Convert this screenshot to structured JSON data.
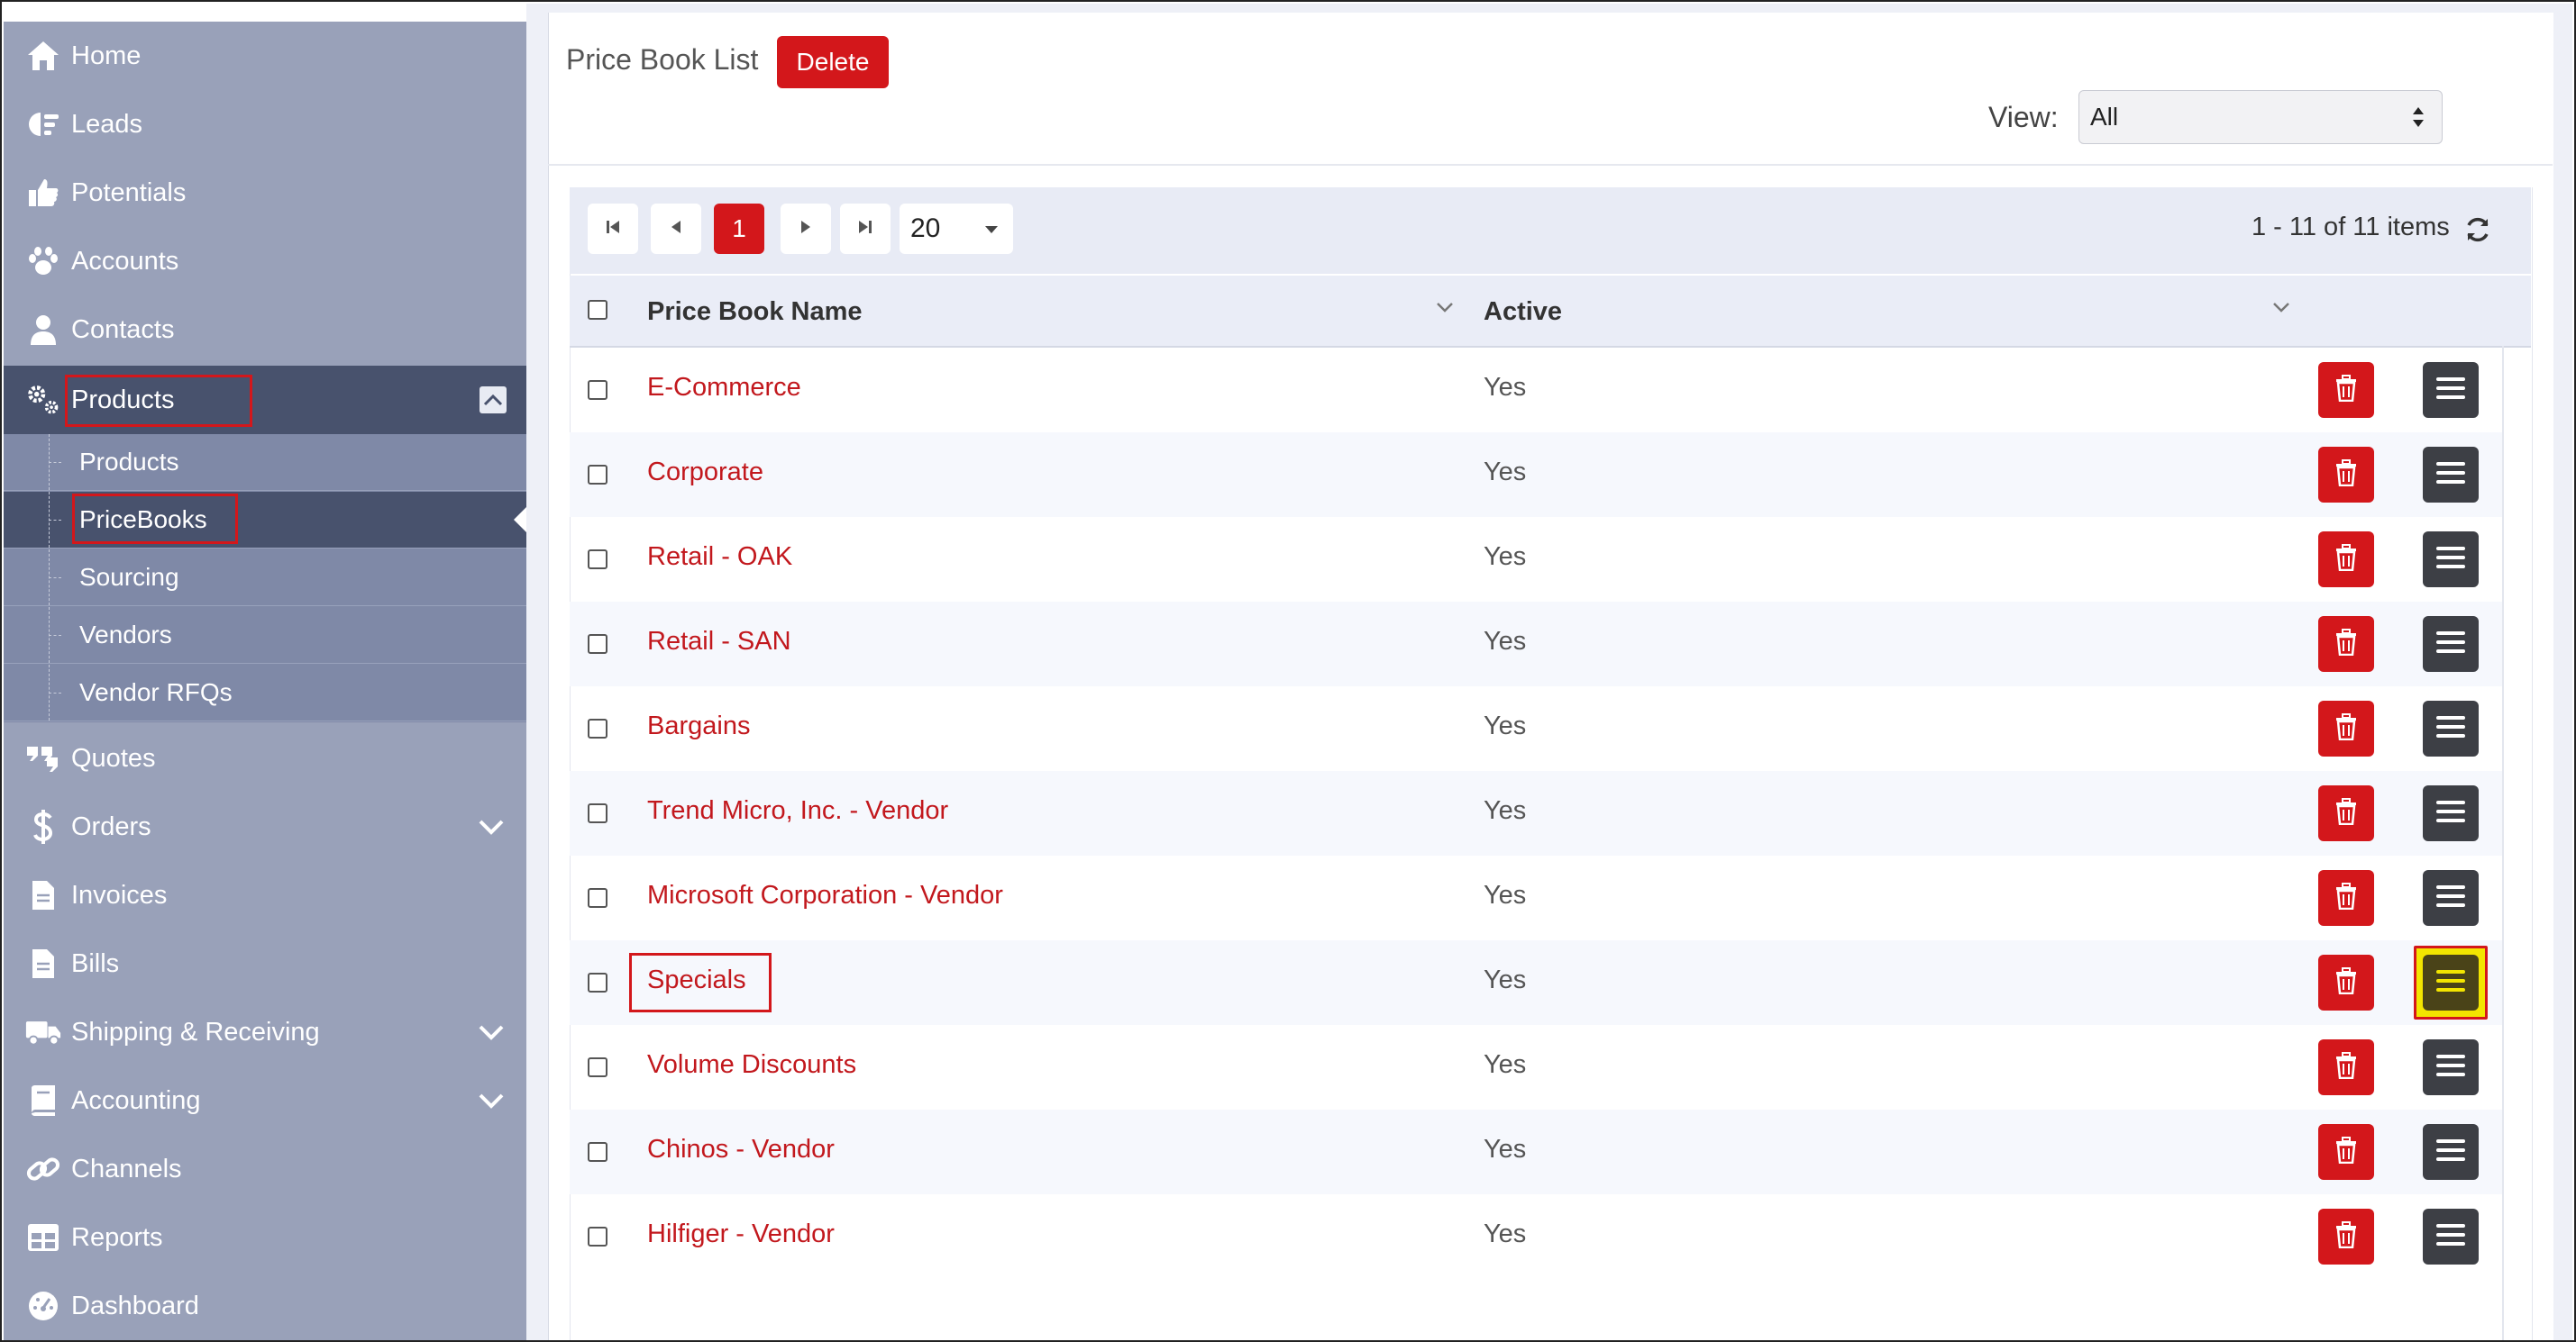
{
  "sidebar": {
    "items": [
      {
        "label": "Home",
        "icon": "home-icon"
      },
      {
        "label": "Leads",
        "icon": "leads-icon"
      },
      {
        "label": "Potentials",
        "icon": "thumbs-up-icon"
      },
      {
        "label": "Accounts",
        "icon": "paw-icon"
      },
      {
        "label": "Contacts",
        "icon": "user-icon"
      },
      {
        "label": "Products",
        "icon": "gears-icon"
      },
      {
        "label": "Quotes",
        "icon": "quote-icon"
      },
      {
        "label": "Orders",
        "icon": "dollar-icon"
      },
      {
        "label": "Invoices",
        "icon": "document-icon"
      },
      {
        "label": "Bills",
        "icon": "document-icon"
      },
      {
        "label": "Shipping & Receiving",
        "icon": "truck-icon"
      },
      {
        "label": "Accounting",
        "icon": "book-icon"
      },
      {
        "label": "Channels",
        "icon": "link-icon"
      },
      {
        "label": "Reports",
        "icon": "table-icon"
      },
      {
        "label": "Dashboard",
        "icon": "gauge-icon"
      }
    ],
    "products_sub": [
      {
        "label": "Products"
      },
      {
        "label": "PriceBooks"
      },
      {
        "label": "Sourcing"
      },
      {
        "label": "Vendors"
      },
      {
        "label": "Vendor RFQs"
      }
    ]
  },
  "page": {
    "title": "Price Book List",
    "delete_label": "Delete",
    "view_label": "View:",
    "view_value": "All"
  },
  "pager": {
    "current_page": "1",
    "page_size": "20",
    "items_info": "1 - 11 of 11 items"
  },
  "table": {
    "columns": [
      "Price Book Name",
      "Active"
    ],
    "rows": [
      {
        "name": "E-Commerce",
        "active": "Yes"
      },
      {
        "name": "Corporate",
        "active": "Yes"
      },
      {
        "name": "Retail - OAK",
        "active": "Yes"
      },
      {
        "name": "Retail - SAN",
        "active": "Yes"
      },
      {
        "name": "Bargains",
        "active": "Yes"
      },
      {
        "name": "Trend Micro, Inc. - Vendor",
        "active": "Yes"
      },
      {
        "name": "Microsoft Corporation - Vendor",
        "active": "Yes"
      },
      {
        "name": "Specials",
        "active": "Yes"
      },
      {
        "name": "Volume Discounts",
        "active": "Yes"
      },
      {
        "name": "Chinos - Vendor",
        "active": "Yes"
      },
      {
        "name": "Hilfiger - Vendor",
        "active": "Yes"
      }
    ]
  },
  "colors": {
    "accent_red": "#d3171b",
    "sidebar_bg": "#99a1b9",
    "sidebar_active": "#48526d",
    "highlight_yellow": "#f3e500"
  }
}
